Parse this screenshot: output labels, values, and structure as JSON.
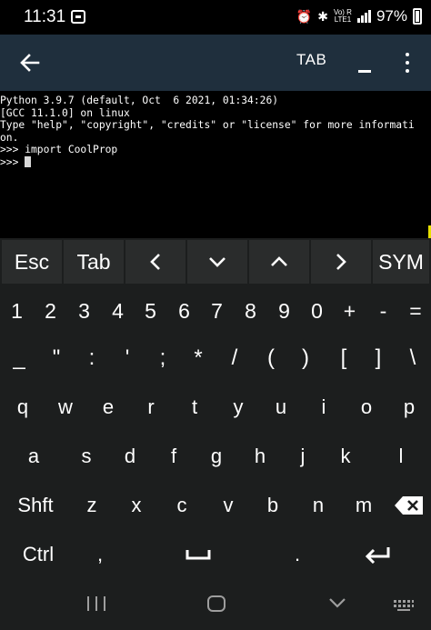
{
  "status_bar": {
    "time": "11:31",
    "battery_percent": "97%",
    "network_label_top": "Vo) R",
    "network_label_bottom": "LTE1"
  },
  "app_bar": {
    "tab_label": "TAB"
  },
  "terminal": {
    "lines": [
      "Python 3.9.7 (default, Oct  6 2021, 01:34:26)",
      "[GCC 11.1.0] on linux",
      "Type \"help\", \"copyright\", \"credits\" or \"license\" for more informati",
      "on.",
      ">>> import CoolProp",
      ">>> "
    ]
  },
  "keyboard": {
    "extra_keys": [
      "Esc",
      "Tab",
      "<",
      "v",
      "^",
      ">",
      "SYM"
    ],
    "number_row": [
      "1",
      "2",
      "3",
      "4",
      "5",
      "6",
      "7",
      "8",
      "9",
      "0",
      "+",
      "-",
      "="
    ],
    "symbol_row": [
      "_",
      "\"",
      ":",
      "'",
      ";",
      "*",
      "/",
      "(",
      ")",
      "[",
      "]",
      "\\"
    ],
    "row_1": [
      "q",
      "w",
      "e",
      "r",
      "t",
      "y",
      "u",
      "i",
      "o",
      "p"
    ],
    "row_2": [
      "a",
      "s",
      "d",
      "f",
      "g",
      "h",
      "j",
      "k",
      "l"
    ],
    "row_3": [
      "Shft",
      "z",
      "x",
      "c",
      "v",
      "b",
      "n",
      "m"
    ],
    "bottom_row": {
      "ctrl": "Ctrl",
      "comma": ",",
      "period": "."
    }
  },
  "colors": {
    "app_bar": "#1f2f3d",
    "keyboard_bg": "#1c1e1e",
    "extra_key_bg": "#2a2c2c",
    "accent": "#e7e000"
  },
  "icons": {
    "back": "arrow-left-icon",
    "menu": "more-vertical-icon",
    "backspace": "backspace-icon",
    "space": "space-bar-icon",
    "enter": "enter-icon"
  }
}
